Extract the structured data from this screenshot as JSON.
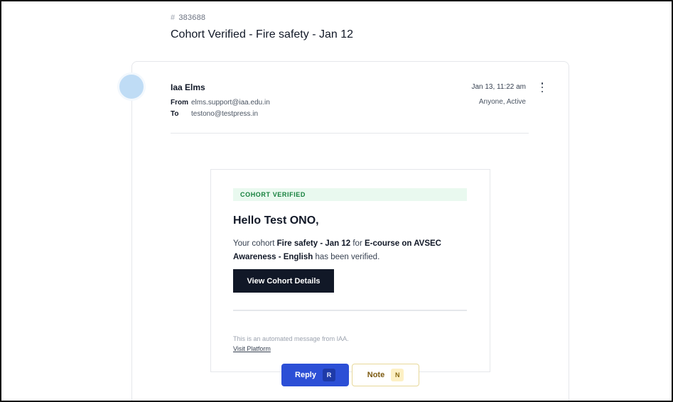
{
  "ticket": {
    "hash": "#",
    "id": "383688",
    "title": "Cohort Verified - Fire safety - Jan 12"
  },
  "message": {
    "sender_name": "Iaa Elms",
    "from_label": "From",
    "from_address": "elms.support@iaa.edu.in",
    "to_label": "To",
    "to_address": "testono@testpress.in",
    "date": "Jan 13, 11:22 am",
    "status": "Anyone, Active"
  },
  "email": {
    "badge": "COHORT VERIFIED",
    "greeting": "Hello Test ONO,",
    "body": {
      "t1": "Your cohort ",
      "cohort": "Fire safety - Jan 12",
      "t2": " for ",
      "course": "E-course on AVSEC Awareness - English",
      "t3": " has been verified."
    },
    "cta_label": "View Cohort Details",
    "footer_text": "This is an automated message from IAA.",
    "footer_link": "Visit Platform"
  },
  "actions": {
    "reply_label": "Reply",
    "reply_key": "R",
    "note_label": "Note",
    "note_key": "N"
  },
  "colors": {
    "reply_button": "#2c4fd6",
    "cta_button": "#111827",
    "badge_bg": "#e9f9ef",
    "badge_text": "#15803d"
  }
}
